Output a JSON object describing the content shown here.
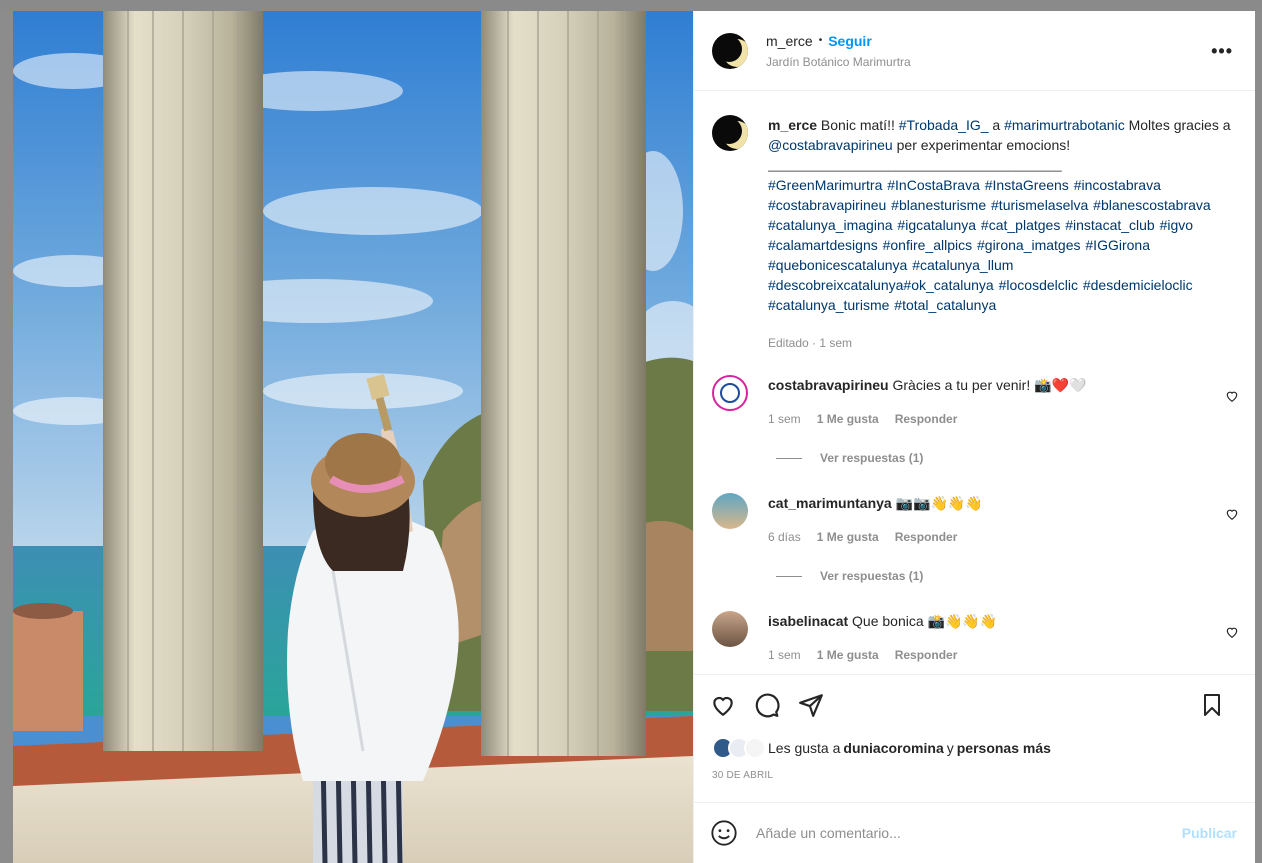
{
  "header": {
    "username": "m_erce",
    "separator": "•",
    "follow_label": "Seguir",
    "location": "Jardín Botánico Marimurtra",
    "more_label": "•••"
  },
  "caption": {
    "username": "m_erce",
    "text_1": " Bonic matí!! ",
    "tag_1": "#Trobada_IG_",
    "text_2": " a ",
    "tag_2": "#marimurtrabotanic",
    "text_3": " Moltes gracies a ",
    "tag_3": "@costabravapirineu",
    "text_4": " per experimentar emocions!",
    "separator_line": "____________________________________________",
    "hashtags": "#GreenMarimurtra #InCostaBrava #InstaGreens #incostabrava #costabravapirineu #blanesturisme #turismelaselva #blanescostabrava #catalunya_imagina #igcatalunya #cat_platges #instacat_club #igvo #calamartdesigns #onfire_allpics #girona_imatges #IGGirona #quebonicescatalunya #catalunya_llum #descobreixcatalunya#ok_catalunya #locosdelclic #desdemicieloclic #catalunya_turisme #total_catalunya",
    "meta": "Editado · 1 sem"
  },
  "comments": [
    {
      "username": "costabravapirineu",
      "text": "Gràcies a tu per venir! 📸❤️🤍",
      "time": "1 sem",
      "likes": "1 Me gusta",
      "reply": "Responder",
      "view_replies": "Ver respuestas (1)"
    },
    {
      "username": "cat_marimuntanya",
      "text": "📷📷👋👋👋",
      "time": "6 días",
      "likes": "1 Me gusta",
      "reply": "Responder",
      "view_replies": "Ver respuestas (1)"
    },
    {
      "username": "isabelinacat",
      "text": "Que bonica 📸👋👋👋",
      "time": "1 sem",
      "likes": "1 Me gusta",
      "reply": "Responder"
    }
  ],
  "likes": {
    "prefix": "Les gusta a ",
    "user": "duniacoromina",
    "middle": " y ",
    "rest": "personas más"
  },
  "date": "30 DE ABRIL",
  "add_comment": {
    "placeholder": "Añade un comentario...",
    "publish_label": "Publicar"
  },
  "colors": {
    "accent": "#0095f6",
    "hashtag": "#00376b",
    "muted": "#8e8e8e"
  }
}
